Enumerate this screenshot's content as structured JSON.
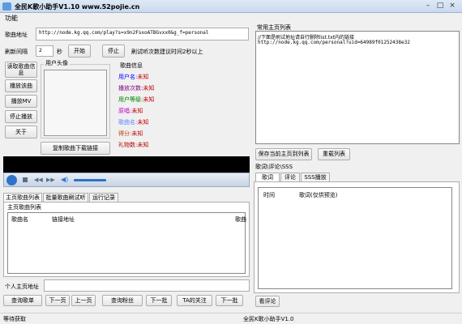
{
  "window": {
    "title": "全民K歌小助手V1.10 www.52pojie.cn"
  },
  "menu": {
    "items": [
      "功能"
    ]
  },
  "song_url": {
    "label": "歌曲地址",
    "value": "http://node.kg.qq.com/play?s=x9n2FsxoATBGvxx0&g_f=personal"
  },
  "refresh": {
    "label": "刷新间隔",
    "value": "2",
    "unit": "秒",
    "start_label": "开始",
    "stop_label": "停止",
    "hint": "刷试听次数建议时间2秒以上"
  },
  "left_buttons": [
    "读取歌曲信息",
    "播放该曲",
    "播放MV",
    "停止播放",
    "关于"
  ],
  "avatar_group": {
    "title": "用户头像"
  },
  "copy_button": "复制歌曲下载链接",
  "song_info": {
    "title": "歌曲信息",
    "fields": [
      {
        "label": "用户名:",
        "value": "未知",
        "color": "#0000ff"
      },
      {
        "label": "播放次数:",
        "value": "未知",
        "color": "#800080"
      },
      {
        "label": "用户等级:",
        "value": "未知",
        "color": "#008000"
      },
      {
        "label": "原唱:",
        "value": "未知",
        "color": "#c000c0"
      },
      {
        "label": "歌曲名:",
        "value": "未知",
        "color": "#6080ff"
      },
      {
        "label": "得分:",
        "value": "未知",
        "color": "#c04000"
      },
      {
        "label": "礼物数:",
        "value": "未知",
        "color": "#c00000"
      }
    ]
  },
  "tabs": [
    "主页歌曲列表",
    "批量歌曲刷试听",
    "运行记录"
  ],
  "song_list": {
    "group_title": "主页歌曲列表",
    "columns": [
      "歌曲名",
      "链接地址",
      "歌曲"
    ]
  },
  "personal_home": {
    "label": "个人主页地址",
    "value": ""
  },
  "bottom_buttons": [
    "查询歌单",
    "下一页",
    "上一页",
    "查询粉丝",
    "下一批",
    "TA的关注",
    "下一批"
  ],
  "status": {
    "left": "等待获取",
    "right": "全民K歌小助手V1.0"
  },
  "common_home": {
    "title": "常用主页列表",
    "lines": [
      "//下面是刷试地址请自行删除list.txt内的链接",
      "http://node.kg.qq.com/personal?uid=64989f01252438e32"
    ],
    "save_label": "保存当前主页到列表",
    "reload_label": "重载列表"
  },
  "comments": {
    "group_title": "歌词\\评论\\SSS",
    "tabs": [
      "歌词",
      "评论",
      "SSS播放"
    ],
    "columns": [
      "时间",
      "歌词(仅供预览)"
    ],
    "view_label": "看评论"
  }
}
